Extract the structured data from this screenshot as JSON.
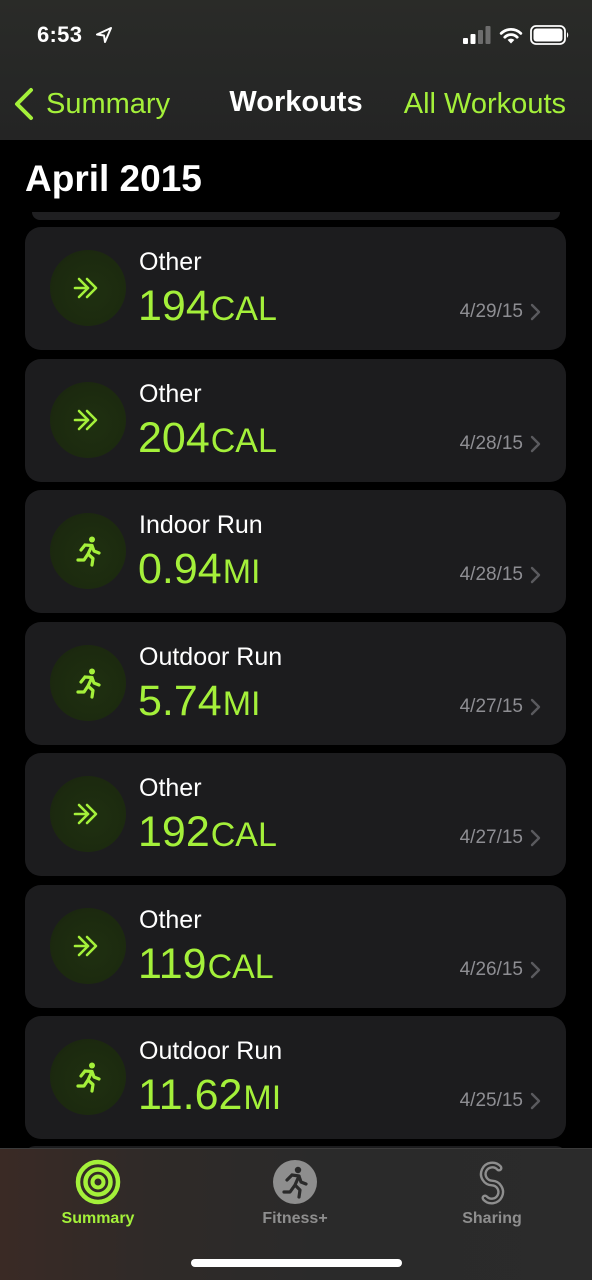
{
  "status_bar": {
    "time": "6:53",
    "icons": [
      "location-arrow-icon",
      "cellular-signal-icon",
      "wifi-icon",
      "battery-icon"
    ]
  },
  "nav": {
    "back_label": "Summary",
    "title": "Workouts",
    "right_label": "All Workouts"
  },
  "section": {
    "title": "April 2015"
  },
  "workouts": [
    {
      "name": "Other",
      "value": "194",
      "unit": "CAL",
      "date": "4/29/15",
      "icon": "other-workout-icon"
    },
    {
      "name": "Other",
      "value": "204",
      "unit": "CAL",
      "date": "4/28/15",
      "icon": "other-workout-icon"
    },
    {
      "name": "Indoor Run",
      "value": "0.94",
      "unit": "MI",
      "date": "4/28/15",
      "icon": "runner-icon"
    },
    {
      "name": "Outdoor Run",
      "value": "5.74",
      "unit": "MI",
      "date": "4/27/15",
      "icon": "runner-icon"
    },
    {
      "name": "Other",
      "value": "192",
      "unit": "CAL",
      "date": "4/27/15",
      "icon": "other-workout-icon"
    },
    {
      "name": "Other",
      "value": "119",
      "unit": "CAL",
      "date": "4/26/15",
      "icon": "other-workout-icon"
    },
    {
      "name": "Outdoor Run",
      "value": "11.62",
      "unit": "MI",
      "date": "4/25/15",
      "icon": "runner-icon"
    }
  ],
  "tabs": [
    {
      "label": "Summary",
      "icon": "activity-rings-icon",
      "active": true
    },
    {
      "label": "Fitness+",
      "icon": "fitness-plus-icon",
      "active": false
    },
    {
      "label": "Sharing",
      "icon": "sharing-icon",
      "active": false
    }
  ],
  "colors": {
    "accent": "#a4f03a",
    "card_bg": "#1c1c1e",
    "secondary_text": "#8e8e93",
    "background": "#000000"
  }
}
